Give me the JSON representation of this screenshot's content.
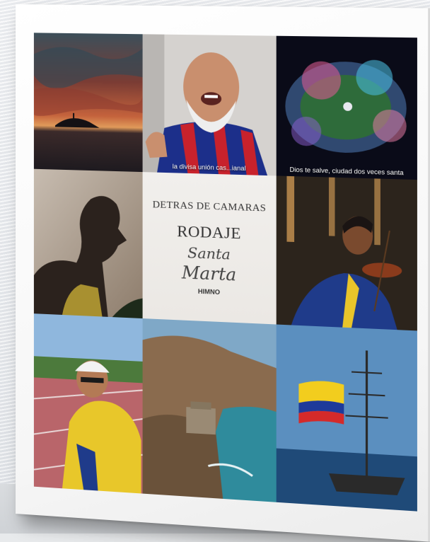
{
  "poster": {
    "center": {
      "line1": "DETRAS DE CAMARAS",
      "line2": "RODAJE",
      "script1": "Santa",
      "script2": "Marta",
      "line3": "HIMNO"
    },
    "tiles": [
      {
        "subject": "sunset-island",
        "caption": ""
      },
      {
        "subject": "smiling-fan-jersey",
        "caption": "la divisa unión cas...ianal"
      },
      {
        "subject": "stadium-fireworks",
        "caption": "Dios te salve, ciudad dos veces santa"
      },
      {
        "subject": "runner-silhouette",
        "caption": ""
      },
      {
        "subject": "violinist-church",
        "caption": ""
      },
      {
        "subject": "cyclist-track",
        "caption": ""
      },
      {
        "subject": "coastal-cliff-ruins",
        "caption": ""
      },
      {
        "subject": "tall-ship-flag",
        "caption": ""
      }
    ]
  },
  "colors": {
    "frame": "#ffffff",
    "background": "#e8eaec",
    "center_panel": "#efece8"
  }
}
